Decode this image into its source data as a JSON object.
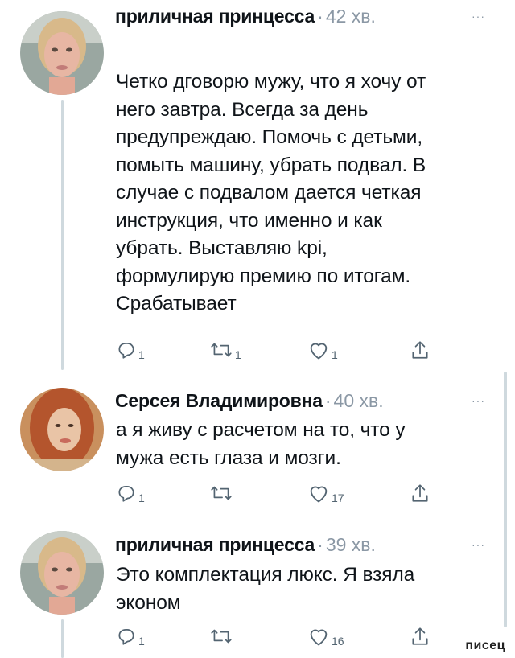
{
  "tweets": [
    {
      "name": "приличная принцесса",
      "time": "42 хв.",
      "text": "Четко дговорю мужу, что я хочу от\nнего завтра. Всегда за день\nпредупреждаю. Помочь с детьми,\nпомыть машину, убрать подвал. В\nслучае с подвалом дается четкая\nинструкция, что именно и как\nубрать.  Выставляю kpi,\nформулирую премию по итогам.\nСрабатывает",
      "reply_count": "1",
      "retweet_count": "1",
      "like_count": "1",
      "avatar": "woman-blonde-avatar"
    },
    {
      "name": "Серсея Владимировна",
      "time": "40 хв.",
      "text": "а я живу с расчетом на то, что у\nмужа есть глаза и мозги.",
      "reply_count": "1",
      "retweet_count": "",
      "like_count": "17",
      "avatar": "woman-redhead-avatar"
    },
    {
      "name": "приличная принцесса",
      "time": "39 хв.",
      "text": "Это комплектация люкс. Я взяла\nэконом",
      "reply_count": "1",
      "retweet_count": "",
      "like_count": "16",
      "avatar": "woman-blonde-avatar"
    }
  ],
  "more_glyph": "···",
  "separator": "·",
  "watermark": "писец",
  "colors": {
    "text": "#0f1419",
    "muted": "#8b98a5",
    "icon": "#536471",
    "thread_line": "#cfd9de"
  }
}
